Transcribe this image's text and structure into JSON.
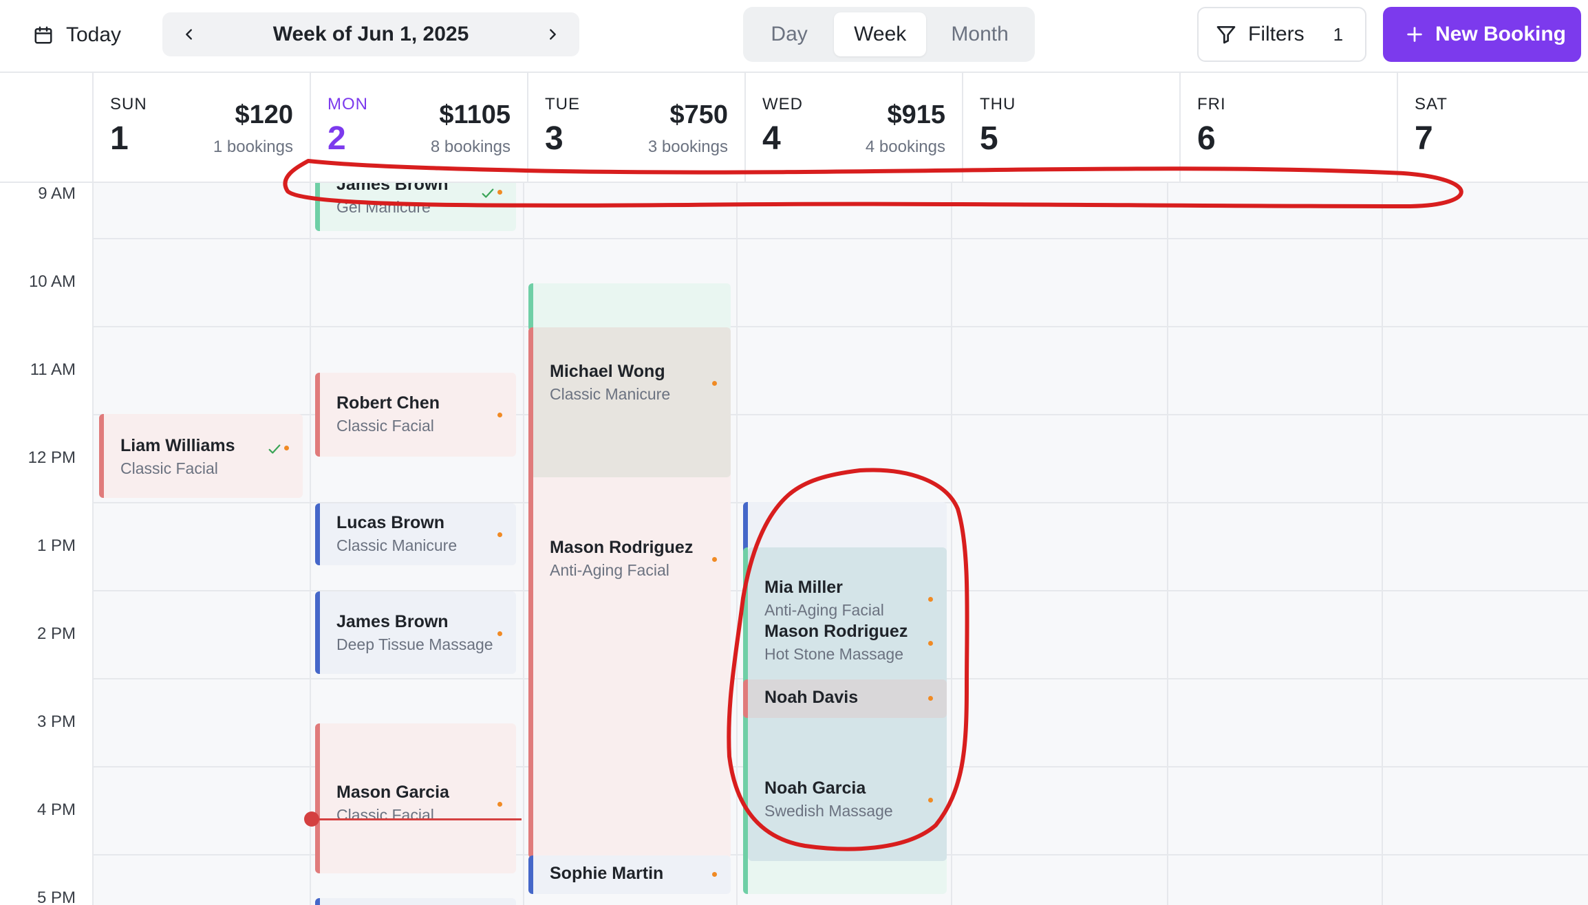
{
  "toolbar": {
    "today_label": "Today",
    "week_label": "Week of Jun 1, 2025",
    "views": [
      "Day",
      "Week",
      "Month"
    ],
    "active_view": "Week",
    "filters_label": "Filters",
    "filters_count": "1",
    "new_booking_label": "New Booking",
    "accent_color": "#7c3aed"
  },
  "days": [
    {
      "name": "SUN",
      "num": "1",
      "revenue": "$120",
      "bookings": "1 bookings"
    },
    {
      "name": "MON",
      "num": "2",
      "revenue": "$1105",
      "bookings": "8 bookings",
      "today": true
    },
    {
      "name": "TUE",
      "num": "3",
      "revenue": "$750",
      "bookings": "3 bookings"
    },
    {
      "name": "WED",
      "num": "4",
      "revenue": "$915",
      "bookings": "4 bookings"
    },
    {
      "name": "THU",
      "num": "5"
    },
    {
      "name": "FRI",
      "num": "6"
    },
    {
      "name": "SAT",
      "num": "7"
    }
  ],
  "times": [
    "9 AM",
    "10 AM",
    "11 AM",
    "12 PM",
    "1 PM",
    "2 PM",
    "3 PM",
    "4 PM",
    "5 PM"
  ],
  "events": {
    "mon_james_top": {
      "name": "James Brown",
      "service": "Gel Manicure"
    },
    "mon_robert": {
      "name": "Robert Chen",
      "service": "Classic Facial"
    },
    "mon_lucas": {
      "name": "Lucas Brown",
      "service": "Classic Manicure"
    },
    "mon_james": {
      "name": "James Brown",
      "service": "Deep Tissue Massage"
    },
    "mon_mason": {
      "name": "Mason Garcia",
      "service": "Classic Facial"
    },
    "sun_liam": {
      "name": "Liam Williams",
      "service": "Classic Facial"
    },
    "tue_michael": {
      "name": "Michael Wong",
      "service": "Classic Manicure"
    },
    "tue_mason": {
      "name": "Mason Rodriguez",
      "service": "Anti-Aging Facial"
    },
    "tue_sophie": {
      "name": "Sophie Martin"
    },
    "wed_mia": {
      "name": "Mia Miller",
      "service": "Anti-Aging Facial"
    },
    "wed_mason": {
      "name": "Mason Rodriguez",
      "service": "Hot Stone Massage"
    },
    "wed_noah_davis": {
      "name": "Noah Davis"
    },
    "wed_noah_garcia": {
      "name": "Noah Garcia",
      "service": "Swedish Massage"
    }
  },
  "colors": {
    "status_dot": "#f08a24",
    "now_line": "#d44040",
    "annotation": "#d81e1e"
  }
}
